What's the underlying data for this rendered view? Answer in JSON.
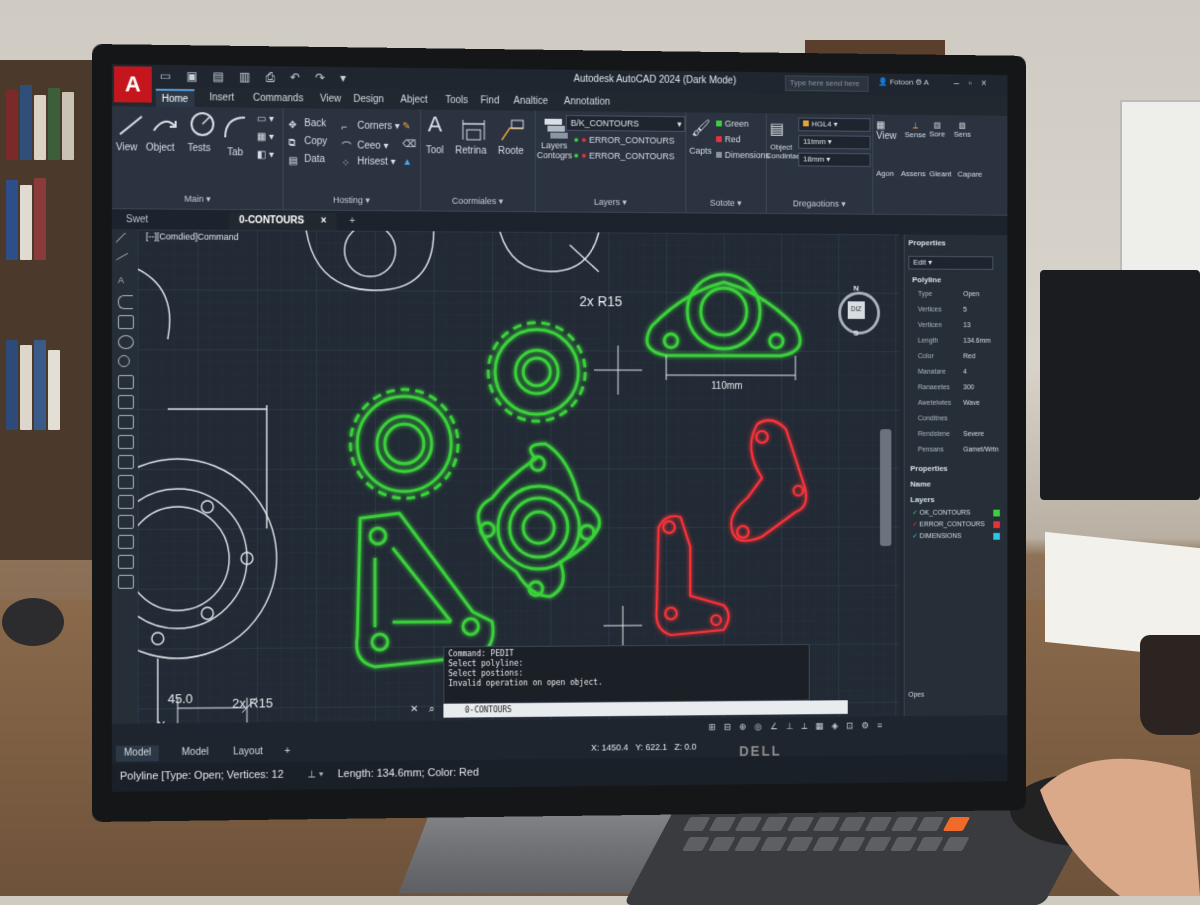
{
  "app": {
    "logo": "A",
    "title": "Autodesk AutoCAD 2024",
    "mode": "(Dark Mode)",
    "search_placeholder": "Type here send here",
    "user": "Fotoon",
    "monitor_brand": "DELL"
  },
  "ribbon_tabs": [
    "Home",
    "Insert",
    "Commands",
    "View",
    "Design",
    "Abject",
    "Tools",
    "Find",
    "Analtice",
    "Annotation"
  ],
  "ribbon": {
    "main": {
      "view": "View",
      "object": "Object",
      "tests": "Tests",
      "tab": "Tab",
      "title": "Main"
    },
    "hosting": {
      "back": "Back",
      "copy": "Copy",
      "data": "Data",
      "corners": "Corners",
      "ceeo": "Ceeo",
      "hrisest": "Hrisest",
      "title": "Hosting"
    },
    "coordinates": {
      "tool": "Tool",
      "retrina": "Retrina",
      "roote": "Roote",
      "title": "Coormiales"
    },
    "layers": {
      "big_label": "Layers Contogrs",
      "combo": "B/K_CONTOURS",
      "items": [
        "ERROR_CONTOURS",
        "ERROR_CONTOURS"
      ],
      "title": "Layers"
    },
    "colors": {
      "green": "Green",
      "red": "Red",
      "dimensions": "Dimensions",
      "capts": "Capts",
      "title": "Sotote"
    },
    "properties": {
      "object_condense": "Object Condintae",
      "combo_main": "HGL4",
      "combo2": "11tmm",
      "combo3": "18mm",
      "title": "Dregaotions"
    },
    "extra": {
      "view": "View",
      "agon": "Agon",
      "sense": "Sense",
      "sore": "Sore",
      "sens": "Sens",
      "assens": "Assens",
      "gleant": "Gleant",
      "capare": "Capare"
    }
  },
  "doc_tabs": {
    "start": "Swet",
    "active": "0-CONTOURS",
    "plus": "+"
  },
  "canvas": {
    "viewport_label": "[--][Comdied]Command",
    "dim_top_radius": "2x R15",
    "dim_110": "110mm",
    "dim_45": "45.0",
    "dim_bottom_radius": "2x R15",
    "axis_y": "Y",
    "axis_x": "X"
  },
  "viewcube": {
    "n": "N",
    "s": "S",
    "face": "DIZ"
  },
  "properties_panel": {
    "title": "Properties",
    "selector": "Edit",
    "section": "Polyline",
    "rows": [
      {
        "k": "Type",
        "v": "Open"
      },
      {
        "k": "Vertices",
        "v": "5"
      },
      {
        "k": "Verticen",
        "v": "13"
      },
      {
        "k": "Length",
        "v": "134.6mm"
      },
      {
        "k": "Color",
        "v": "Red"
      },
      {
        "k": "Manatare",
        "v": "4"
      },
      {
        "k": "Ranaeetes",
        "v": "300"
      },
      {
        "k": "Awetelwtes",
        "v": "Wave"
      },
      {
        "k": "Conditnes",
        "v": ""
      },
      {
        "k": "Rendstene",
        "v": "Severe"
      },
      {
        "k": "Pensans",
        "v": "Gamet/Wrtn"
      }
    ],
    "sec2": "Properties",
    "sec3": "Name",
    "layers_title": "Layers",
    "layers": [
      {
        "name": "OK_CONTOURS",
        "color": "#3ad13a"
      },
      {
        "name": "ERROR_CONTOURS",
        "color": "#e8323a"
      },
      {
        "name": "DIMENSIONS",
        "color": "#2ec6e6"
      }
    ],
    "footer": "Opes"
  },
  "command_history": [
    "Command: PEDIT",
    "Select polyline:",
    "Select postions:",
    "Invalid operation on open object."
  ],
  "command_line": "0-CONTOURS",
  "layout_tabs": [
    "Model",
    "Model",
    "Layout",
    "+"
  ],
  "coords": {
    "x": "X: 1450.4",
    "y": "Y: 622.1",
    "z": "Z: 0.0"
  },
  "status_bar": {
    "left": "Polyline [Type: Open; Vertices: 12",
    "right": "Length: 134.6mm; Color: Red"
  },
  "colors": {
    "ok": "#3ad13a",
    "error": "#ff3338",
    "bg": "#222a35"
  }
}
